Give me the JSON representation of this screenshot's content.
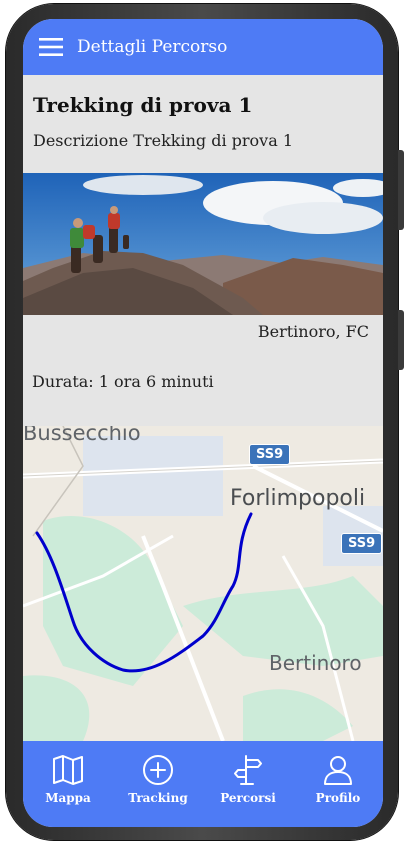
{
  "header": {
    "title": "Dettagli Percorso",
    "menu_icon": "menu-icon"
  },
  "trek": {
    "title": "Trekking di prova 1",
    "description": "Descrizione Trekking di prova 1",
    "location": "Bertinoro, FC",
    "duration": "Durata: 1 ora 6 minuti"
  },
  "map": {
    "labels": {
      "bussecchio": "Bussecchio",
      "forlimpopoli": "Forlimpopoli",
      "bertinoro": "Bertinoro"
    },
    "road_shields": [
      "SS9",
      "SS9"
    ],
    "route_color": "#0000cc"
  },
  "nav": {
    "items": [
      {
        "label": "Mappa",
        "icon": "map-icon"
      },
      {
        "label": "Tracking",
        "icon": "plus-circle-icon"
      },
      {
        "label": "Percorsi",
        "icon": "signpost-icon"
      },
      {
        "label": "Profilo",
        "icon": "person-icon"
      }
    ]
  },
  "colors": {
    "accent": "#4e7bf5",
    "background": "#e5e5e5"
  }
}
